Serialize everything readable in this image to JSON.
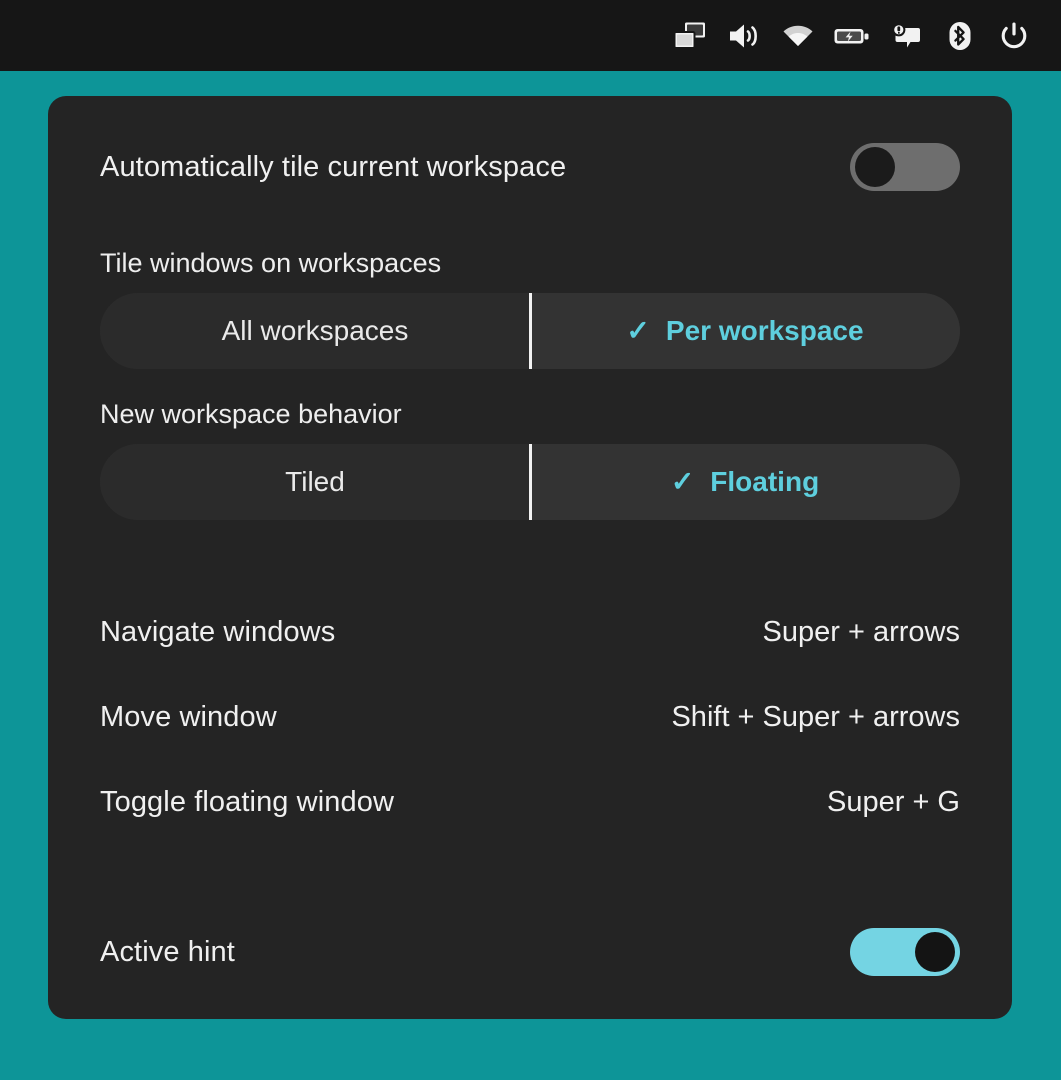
{
  "topbar": {
    "icons": [
      {
        "name": "display-windows-icon",
        "label": "Displays"
      },
      {
        "name": "volume-icon",
        "label": "Volume"
      },
      {
        "name": "wifi-icon",
        "label": "Wi-Fi"
      },
      {
        "name": "battery-charging-icon",
        "label": "Battery"
      },
      {
        "name": "notification-bubble-icon",
        "label": "Notifications"
      },
      {
        "name": "bluetooth-icon",
        "label": "Bluetooth"
      },
      {
        "name": "power-icon",
        "label": "Power"
      }
    ]
  },
  "panel": {
    "auto_tile": {
      "label": "Automatically tile current workspace",
      "toggle_state": "off"
    },
    "tile_windows": {
      "label": "Tile windows on workspaces",
      "options": [
        {
          "label": "All workspaces",
          "active": false
        },
        {
          "label": "Per workspace",
          "active": true,
          "check": "✓"
        }
      ]
    },
    "new_workspace": {
      "label": "New workspace behavior",
      "options": [
        {
          "label": "Tiled",
          "active": false
        },
        {
          "label": "Floating",
          "active": true,
          "check": "✓"
        }
      ]
    },
    "shortcuts": [
      {
        "label": "Navigate windows",
        "value": "Super + arrows"
      },
      {
        "label": "Move window",
        "value": "Shift + Super + arrows"
      },
      {
        "label": "Toggle floating window",
        "value": "Super + G"
      }
    ],
    "active_hint": {
      "label": "Active hint",
      "toggle_state": "on"
    }
  },
  "colors": {
    "desktop_background": "#0d9598",
    "panel_background": "#242424",
    "topbar_background": "#161616",
    "accent_cyan": "#5ecfde",
    "toggle_on": "#74d4e3",
    "toggle_off": "#6e6e6e",
    "text_primary": "#f0f0f0"
  }
}
